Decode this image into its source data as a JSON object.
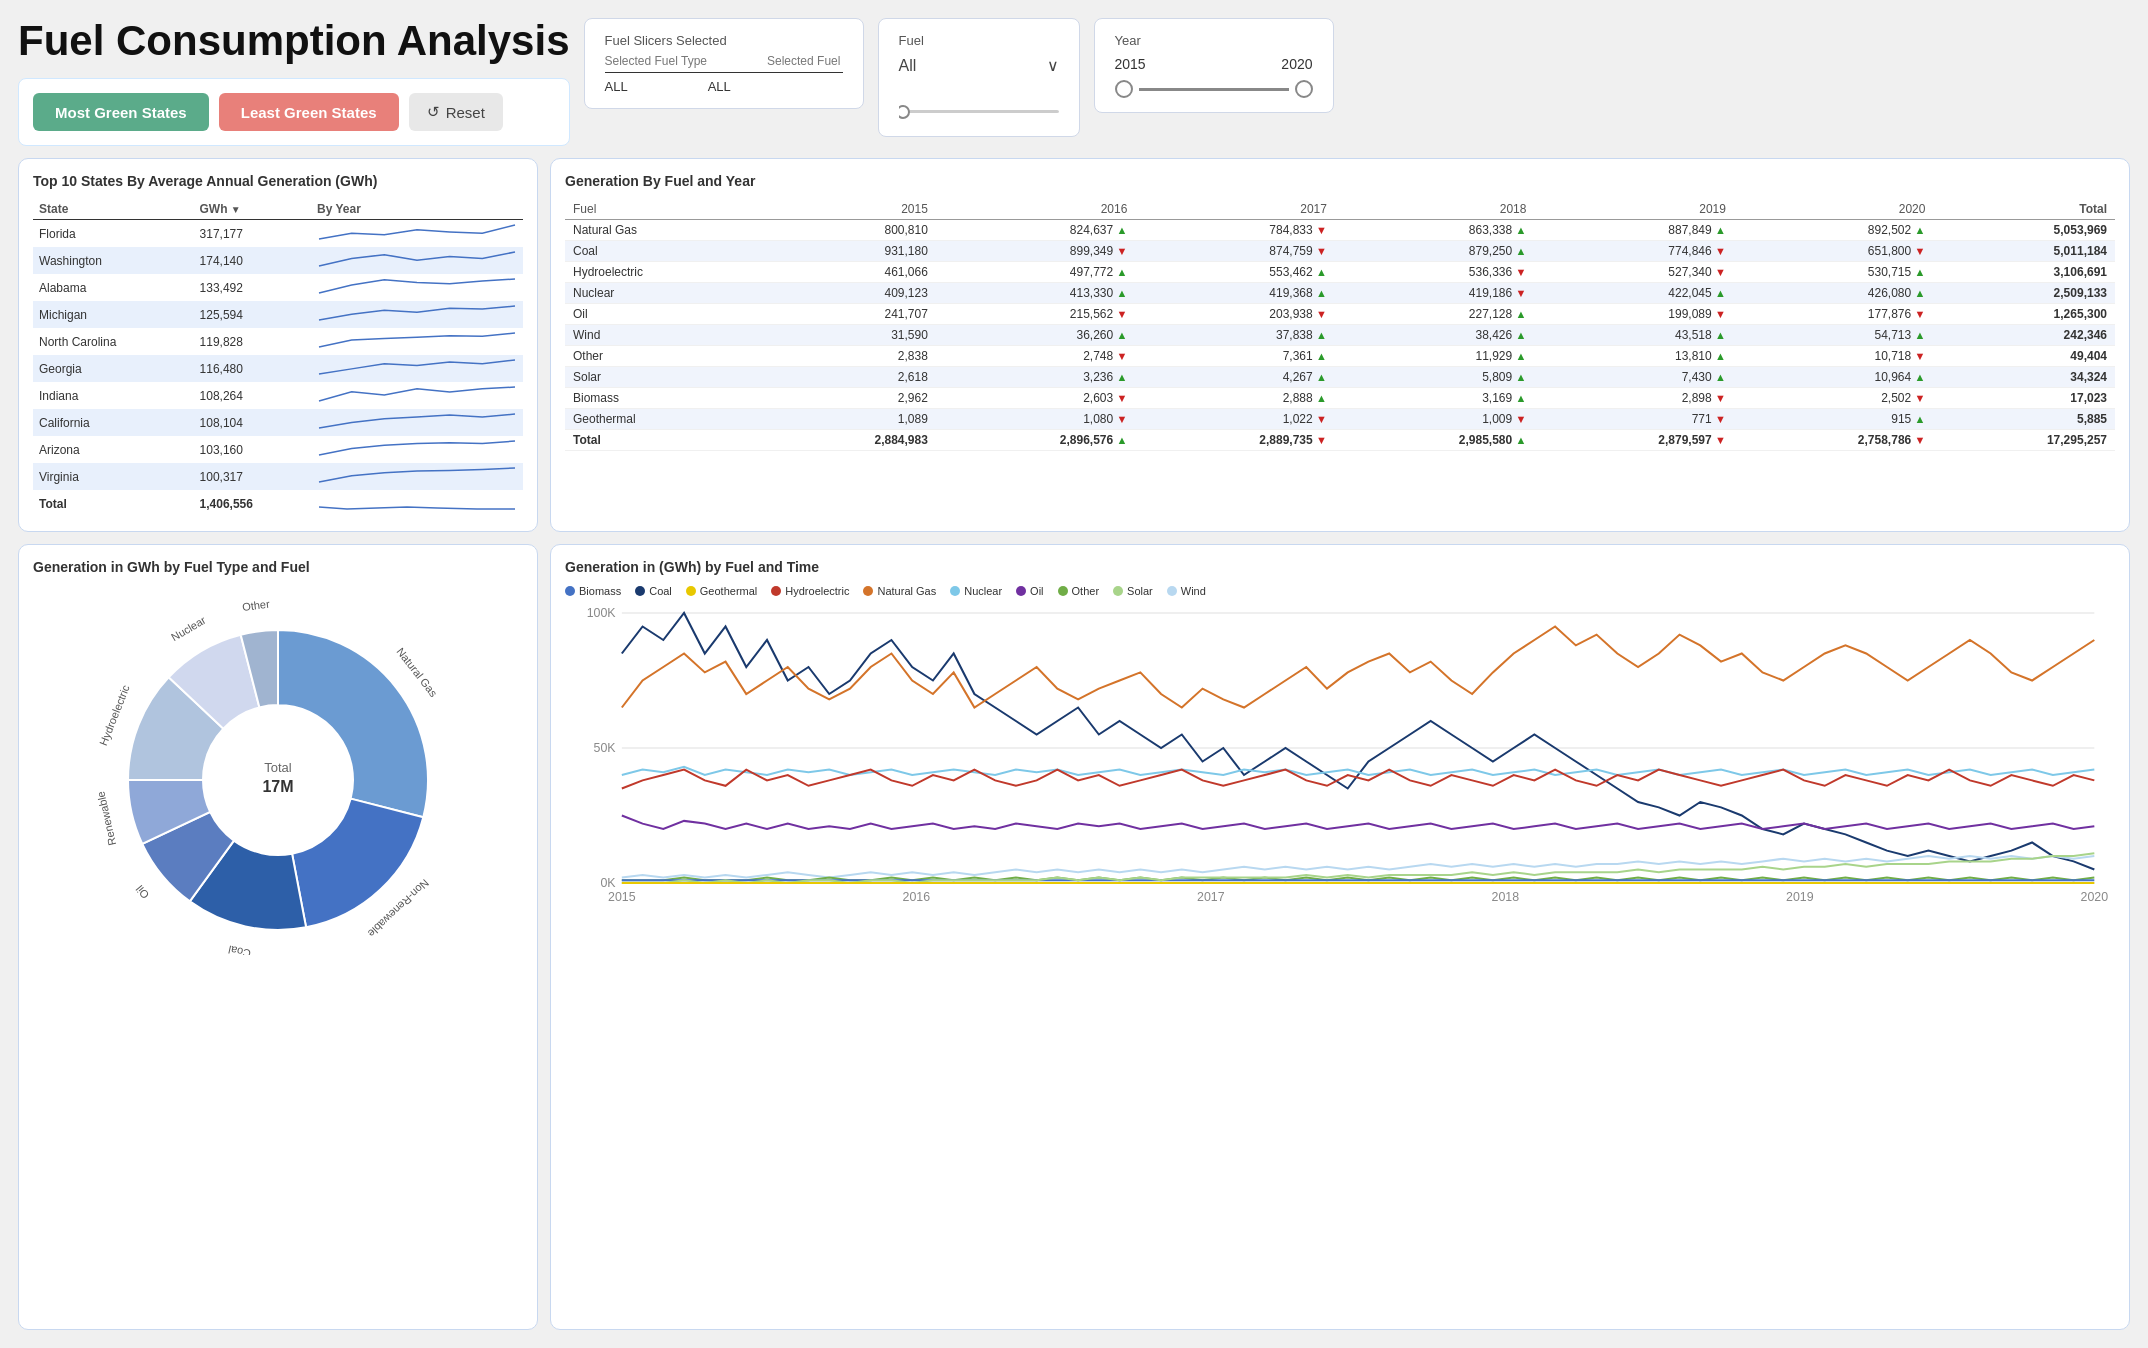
{
  "title": "Fuel Consumption Analysis",
  "buttons": {
    "most_green": "Most Green States",
    "least_green": "Least Green States",
    "reset": "Reset"
  },
  "slicer": {
    "title": "Fuel Slicers Selected",
    "col1": "Selected Fuel Type",
    "col2": "Selected Fuel",
    "val1": "ALL",
    "val2": "ALL"
  },
  "fuel_filter": {
    "label": "Fuel",
    "value": "All"
  },
  "year_filter": {
    "label": "Year",
    "from": "2015",
    "to": "2020"
  },
  "states_table": {
    "title": "Top 10 States By Average Annual Generation (GWh)",
    "headers": [
      "State",
      "GWh",
      "By Year"
    ],
    "rows": [
      {
        "state": "Florida",
        "gwh": "317,177",
        "highlight": false
      },
      {
        "state": "Washington",
        "gwh": "174,140",
        "highlight": true
      },
      {
        "state": "Alabama",
        "gwh": "133,492",
        "highlight": false
      },
      {
        "state": "Michigan",
        "gwh": "125,594",
        "highlight": true
      },
      {
        "state": "North Carolina",
        "gwh": "119,828",
        "highlight": false
      },
      {
        "state": "Georgia",
        "gwh": "116,480",
        "highlight": true
      },
      {
        "state": "Indiana",
        "gwh": "108,264",
        "highlight": false
      },
      {
        "state": "California",
        "gwh": "108,104",
        "highlight": true
      },
      {
        "state": "Arizona",
        "gwh": "103,160",
        "highlight": false
      },
      {
        "state": "Virginia",
        "gwh": "100,317",
        "highlight": true
      }
    ],
    "total_label": "Total",
    "total_val": "1,406,556"
  },
  "fuel_year_table": {
    "title": "Generation By Fuel and Year",
    "headers": [
      "Fuel",
      "2015",
      "2016",
      "2017",
      "2018",
      "2019",
      "2020",
      "Total"
    ],
    "rows": [
      {
        "fuel": "Natural Gas",
        "y2015": "800,810",
        "y2016": "824,637",
        "d2016": "up",
        "y2017": "784,833",
        "d2017": "down",
        "y2018": "863,338",
        "d2018": "up",
        "y2019": "887,849",
        "d2019": "up",
        "y2020": "892,502",
        "d2020": "up",
        "total": "5,053,969",
        "highlight": false
      },
      {
        "fuel": "Coal",
        "y2015": "931,180",
        "y2016": "899,349",
        "d2016": "down",
        "y2017": "874,759",
        "d2017": "down",
        "y2018": "879,250",
        "d2018": "up",
        "y2019": "774,846",
        "d2019": "down",
        "y2020": "651,800",
        "d2020": "down",
        "total": "5,011,184",
        "highlight": true
      },
      {
        "fuel": "Hydroelectric",
        "y2015": "461,066",
        "y2016": "497,772",
        "d2016": "up",
        "y2017": "553,462",
        "d2017": "up",
        "y2018": "536,336",
        "d2018": "down",
        "y2019": "527,340",
        "d2019": "down",
        "y2020": "530,715",
        "d2020": "up",
        "total": "3,106,691",
        "highlight": false
      },
      {
        "fuel": "Nuclear",
        "y2015": "409,123",
        "y2016": "413,330",
        "d2016": "up",
        "y2017": "419,368",
        "d2017": "up",
        "y2018": "419,186",
        "d2018": "down",
        "y2019": "422,045",
        "d2019": "up",
        "y2020": "426,080",
        "d2020": "up",
        "total": "2,509,133",
        "highlight": true
      },
      {
        "fuel": "Oil",
        "y2015": "241,707",
        "y2016": "215,562",
        "d2016": "down",
        "y2017": "203,938",
        "d2017": "down",
        "y2018": "227,128",
        "d2018": "up",
        "y2019": "199,089",
        "d2019": "down",
        "y2020": "177,876",
        "d2020": "down",
        "total": "1,265,300",
        "highlight": false
      },
      {
        "fuel": "Wind",
        "y2015": "31,590",
        "y2016": "36,260",
        "d2016": "up",
        "y2017": "37,838",
        "d2017": "up",
        "y2018": "38,426",
        "d2018": "up",
        "y2019": "43,518",
        "d2019": "up",
        "y2020": "54,713",
        "d2020": "up",
        "total": "242,346",
        "highlight": true
      },
      {
        "fuel": "Other",
        "y2015": "2,838",
        "y2016": "2,748",
        "d2016": "down",
        "y2017": "7,361",
        "d2017": "up",
        "y2018": "11,929",
        "d2018": "up",
        "y2019": "13,810",
        "d2019": "up",
        "y2020": "10,718",
        "d2020": "down",
        "total": "49,404",
        "highlight": false
      },
      {
        "fuel": "Solar",
        "y2015": "2,618",
        "y2016": "3,236",
        "d2016": "up",
        "y2017": "4,267",
        "d2017": "up",
        "y2018": "5,809",
        "d2018": "up",
        "y2019": "7,430",
        "d2019": "up",
        "y2020": "10,964",
        "d2020": "up",
        "total": "34,324",
        "highlight": true
      },
      {
        "fuel": "Biomass",
        "y2015": "2,962",
        "y2016": "2,603",
        "d2016": "down",
        "y2017": "2,888",
        "d2017": "up",
        "y2018": "3,169",
        "d2018": "up",
        "y2019": "2,898",
        "d2019": "down",
        "y2020": "2,502",
        "d2020": "down",
        "total": "17,023",
        "highlight": false
      },
      {
        "fuel": "Geothermal",
        "y2015": "1,089",
        "y2016": "1,080",
        "d2016": "down",
        "y2017": "1,022",
        "d2017": "down",
        "y2018": "1,009",
        "d2018": "down",
        "y2019": "771",
        "d2019": "down",
        "y2020": "915",
        "d2020": "up",
        "total": "5,885",
        "highlight": true
      }
    ],
    "total_row": {
      "label": "Total",
      "y2015": "2,884,983",
      "y2016": "2,896,576",
      "d2016": "up",
      "y2017": "2,889,735",
      "d2017": "down",
      "y2018": "2,985,580",
      "d2018": "up",
      "y2019": "2,879,597",
      "d2019": "down",
      "y2020": "2,758,786",
      "d2020": "down",
      "total": "17,295,257"
    }
  },
  "donut_chart": {
    "title": "Generation in GWh by Fuel Type and Fuel",
    "center_label": "Total",
    "center_value": "17M",
    "segments": [
      {
        "label": "Natural Gas",
        "color": "#6b9bd2",
        "pct": 0.29
      },
      {
        "label": "Non-Renewable",
        "color": "#4472c4",
        "pct": 0.18
      },
      {
        "label": "Coal",
        "color": "#2d5fa8",
        "pct": 0.13
      },
      {
        "label": "Oil",
        "color": "#5b7dc0",
        "pct": 0.08
      },
      {
        "label": "Renewable",
        "color": "#8fa8d8",
        "pct": 0.07
      },
      {
        "label": "Hydroelectric",
        "color": "#b0c4de",
        "pct": 0.12
      },
      {
        "label": "Nuclear",
        "color": "#d0d8ee",
        "pct": 0.09
      },
      {
        "label": "Other",
        "color": "#a0b4d0",
        "pct": 0.04
      }
    ]
  },
  "line_chart": {
    "title": "Generation in (GWh) by Fuel and Time",
    "legend": [
      {
        "label": "Biomass",
        "color": "#4472c4"
      },
      {
        "label": "Coal",
        "color": "#1a3a6e"
      },
      {
        "label": "Geothermal",
        "color": "#e8c800"
      },
      {
        "label": "Hydroelectric",
        "color": "#c0392b"
      },
      {
        "label": "Natural Gas",
        "color": "#d4742a"
      },
      {
        "label": "Nuclear",
        "color": "#7ec8e8"
      },
      {
        "label": "Oil",
        "color": "#7030a0"
      },
      {
        "label": "Other",
        "color": "#70ad47"
      },
      {
        "label": "Solar",
        "color": "#a8d48a"
      },
      {
        "label": "Wind",
        "color": "#b8d8f0"
      }
    ],
    "y_labels": [
      "100K",
      "50K",
      "0K"
    ],
    "x_labels": [
      "2015",
      "2016",
      "2017",
      "2018",
      "2019",
      "2020"
    ]
  }
}
